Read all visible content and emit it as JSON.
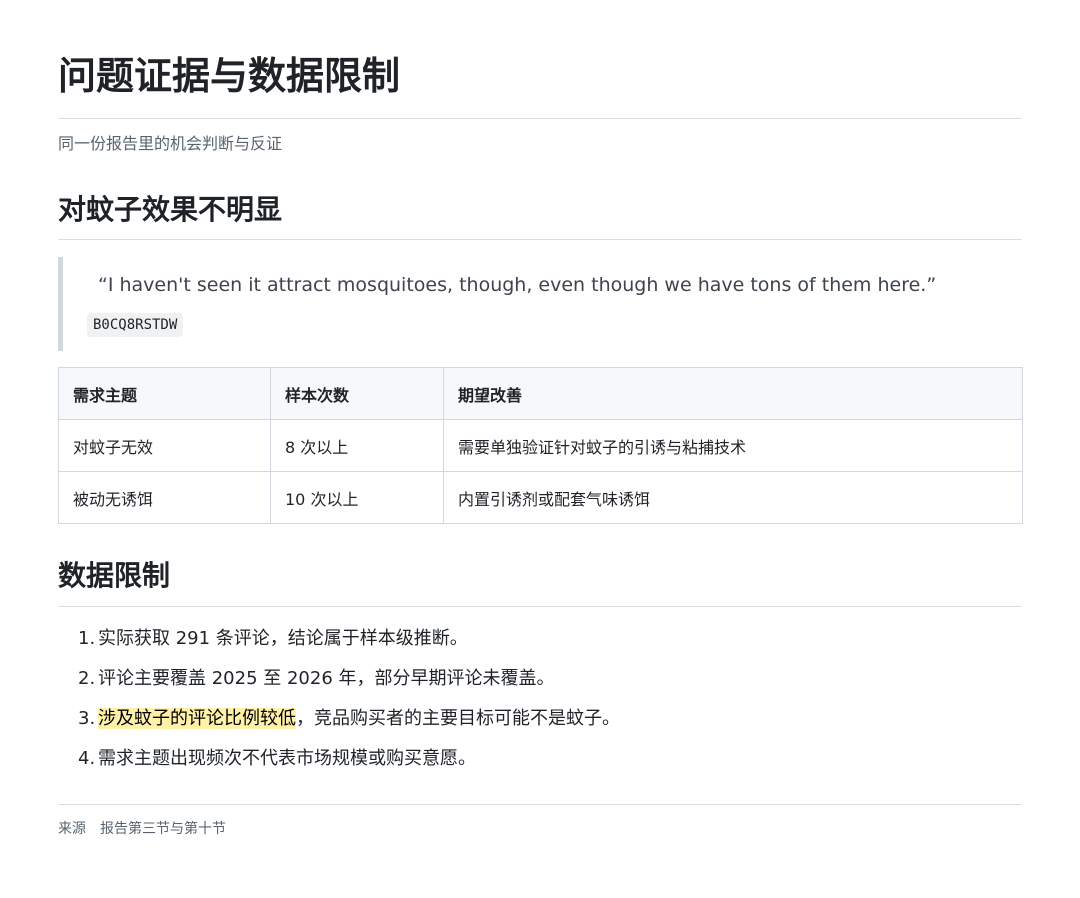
{
  "page": {
    "title": "问题证据与数据限制",
    "subtitle": "同一份报告里的机会判断与反证"
  },
  "section1": {
    "heading": "对蚊子效果不明显",
    "quote": "“I haven't seen it attract mosquitoes, though, even though we have tons of them here.”",
    "quote_source": "B0CQ8RSTDW"
  },
  "table": {
    "headers": [
      "需求主题",
      "样本次数",
      "期望改善"
    ],
    "rows": [
      [
        "对蚊子无效",
        "8 次以上",
        "需要单独验证针对蚊子的引诱与粘捕技术"
      ],
      [
        "被动无诱饵",
        "10 次以上",
        "内置引诱剂或配套气味诱饵"
      ]
    ]
  },
  "section2": {
    "heading": "数据限制",
    "items": [
      {
        "num": "1.",
        "text": "实际获取 291 条评论，结论属于样本级推断。"
      },
      {
        "num": "2.",
        "text": "评论主要覆盖 2025 至 2026 年，部分早期评论未覆盖。"
      },
      {
        "num": "3.",
        "highlight": "涉及蚊子的评论比例较低",
        "text": "，竞品购买者的主要目标可能不是蚊子。"
      },
      {
        "num": "4.",
        "text": "需求主题出现频次不代表市场规模或购买意愿。"
      }
    ]
  },
  "footer": {
    "label": "来源",
    "value": "报告第三节与第十节"
  },
  "colors": {
    "text": "#1f2328",
    "muted": "#59636e",
    "rule": "#d8dee4",
    "highlight": "#fff1a8",
    "table_header_bg": "#f6f8fa"
  }
}
